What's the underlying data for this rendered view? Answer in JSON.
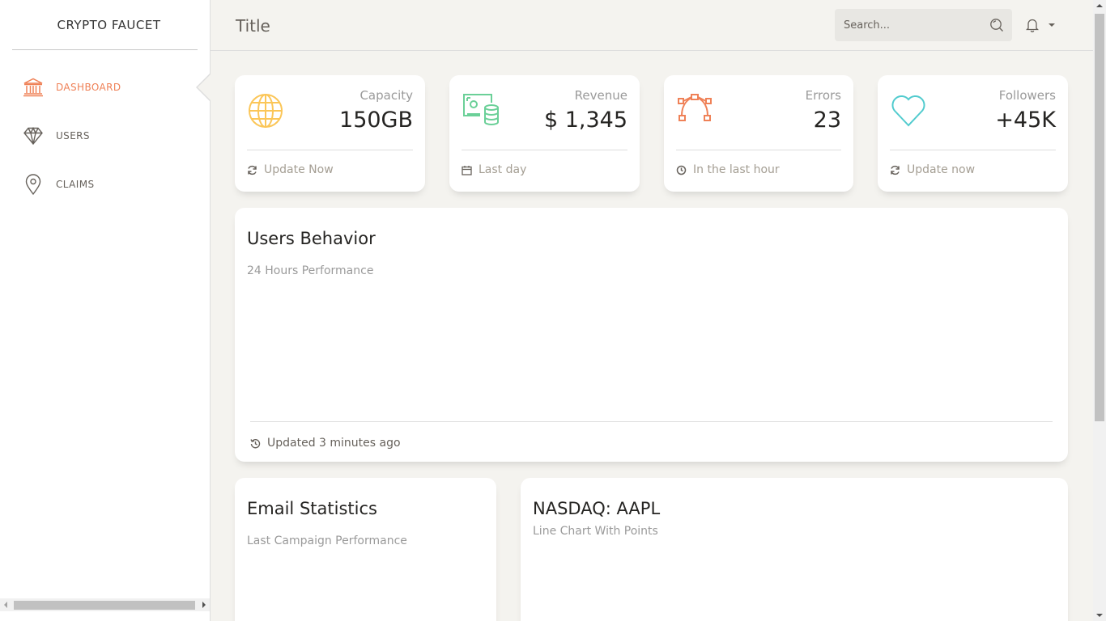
{
  "sidebar": {
    "brand": "CRYPTO FAUCET",
    "items": [
      {
        "label": "DASHBOARD",
        "icon": "bank-icon",
        "active": true
      },
      {
        "label": "USERS",
        "icon": "diamond-icon",
        "active": false
      },
      {
        "label": "CLAIMS",
        "icon": "map-pin-icon",
        "active": false
      }
    ]
  },
  "header": {
    "title": "Title",
    "search_placeholder": "Search..."
  },
  "stats": [
    {
      "category": "Capacity",
      "value": "150GB",
      "footer": "Update Now",
      "icon": "globe-icon",
      "footer_icon": "refresh-icon",
      "color": "#fbc658"
    },
    {
      "category": "Revenue",
      "value": "$ 1,345",
      "footer": "Last day",
      "icon": "money-coins-icon",
      "footer_icon": "calendar-icon",
      "color": "#6bd098"
    },
    {
      "category": "Errors",
      "value": "23",
      "footer": "In the last hour",
      "icon": "vector-icon",
      "footer_icon": "clock-icon",
      "color": "#ef8157"
    },
    {
      "category": "Followers",
      "value": "+45K",
      "footer": "Update now",
      "icon": "heart-icon",
      "footer_icon": "refresh-icon",
      "color": "#51cbce"
    }
  ],
  "users_behavior": {
    "title": "Users Behavior",
    "subtitle": "24 Hours Performance",
    "footer": "Updated 3 minutes ago"
  },
  "email_stats": {
    "title": "Email Statistics",
    "subtitle": "Last Campaign Performance"
  },
  "nasdaq": {
    "title": "NASDAQ: AAPL",
    "subtitle": "Line Chart With Points"
  },
  "colors": {
    "accent": "#ef8157",
    "background": "#f4f3ef",
    "muted": "#9a9a9a"
  }
}
